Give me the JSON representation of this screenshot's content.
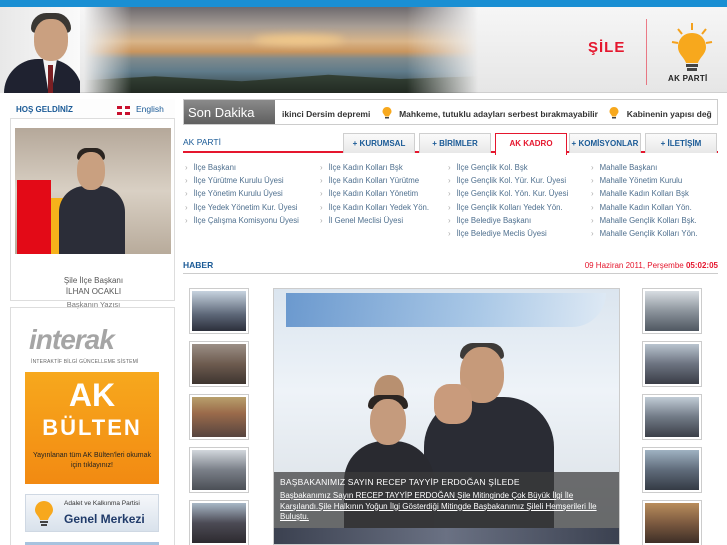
{
  "header": {
    "city": "ŞİLE",
    "logo_text": "AK PARTİ"
  },
  "sidebar": {
    "welcome": "HOŞ GELDİNİZ",
    "language": "English",
    "profile_title": "Şile İlçe Başkanı",
    "profile_name": "İLHAN OCAKLI",
    "profile_link": "Başkanın Yazısı",
    "interak_logo": "interak",
    "interak_sub": "İNTERAKTİF BİLGİ GÜNCELLEME SİSTEMİ",
    "bulten_big1": "AK",
    "bulten_big2": "BÜLTEN",
    "bulten_text": "Yayınlanan tüm AK Bülten'leri okumak için tıklayınız!",
    "merkez_small": "Adalet ve Kalkınma Partisi",
    "merkez_big": "Genel Merkezi"
  },
  "ticker": {
    "label": "Son Dakika",
    "items": [
      "ikinci Dersim depremi",
      "Mahkeme, tutuklu adayları serbest bırakmayabilir",
      "Kabinenin yapısı değ"
    ]
  },
  "nav": {
    "brand": "AK PARTİ",
    "tabs": [
      "+ KURUMSAL",
      "+ BİRİMLER",
      "AK KADRO",
      "+ KOMİSYONLAR",
      "+ İLETİŞİM"
    ],
    "active_index": 2
  },
  "menu": {
    "columns": [
      [
        "İlçe Başkanı",
        "İlçe Yürütme Kurulu Üyesi",
        "İlçe Yönetim Kurulu Üyesi",
        "İlçe Yedek Yönetim Kur. Üyesi",
        "İlçe Çalışma Komisyonu Üyesi"
      ],
      [
        "İlçe Kadın Kolları Bşk",
        "İlçe Kadın Kolları Yürütme",
        "İlçe Kadın Kolları Yönetim",
        "İlçe Kadın Kolları Yedek Yön.",
        "İl Genel Meclisi Üyesi"
      ],
      [
        "İlçe Gençlik Kol. Bşk",
        "İlçe Gençlik Kol. Yür. Kur. Üyesi",
        "İlçe Gençlik Kol. Yön. Kur. Üyesi",
        "İlçe Gençlik Kolları Yedek Yön.",
        "İlçe Belediye Başkanı",
        "İlçe Belediye Meclis Üyesi"
      ],
      [
        "Mahalle Başkanı",
        "Mahalle Yönetim Kurulu",
        "Mahalle Kadın Kolları Bşk",
        "Mahalle Kadın Kolları Yön.",
        "Mahalle Gençlik Kolları Bşk.",
        "Mahalle Gençlik Kolları Yön."
      ]
    ]
  },
  "haber": {
    "title": "HABER",
    "date": "09 Haziran 2011",
    "day": "Perşembe",
    "time": "05:02:05"
  },
  "feature": {
    "title": "BAŞBAKANIMIZ SAYIN RECEP TAYYİP ERDOĞAN ŞİLEDE",
    "body": "Başbakanımız Sayın RECEP TAYYİP ERDOĞAN Şile Mitinginde Çok Büyük İlgi İle Karşılandı.Şile Halkının Yoğun İlgi Gösterdiği Mitingde Başbakanımız Şileli Hemşerileri İle Buluştu."
  },
  "colors": {
    "accent_red": "#e5172e",
    "link_blue": "#1a5a96",
    "top_bar": "#1a8fd3",
    "ak_orange": "#f7a81d"
  }
}
